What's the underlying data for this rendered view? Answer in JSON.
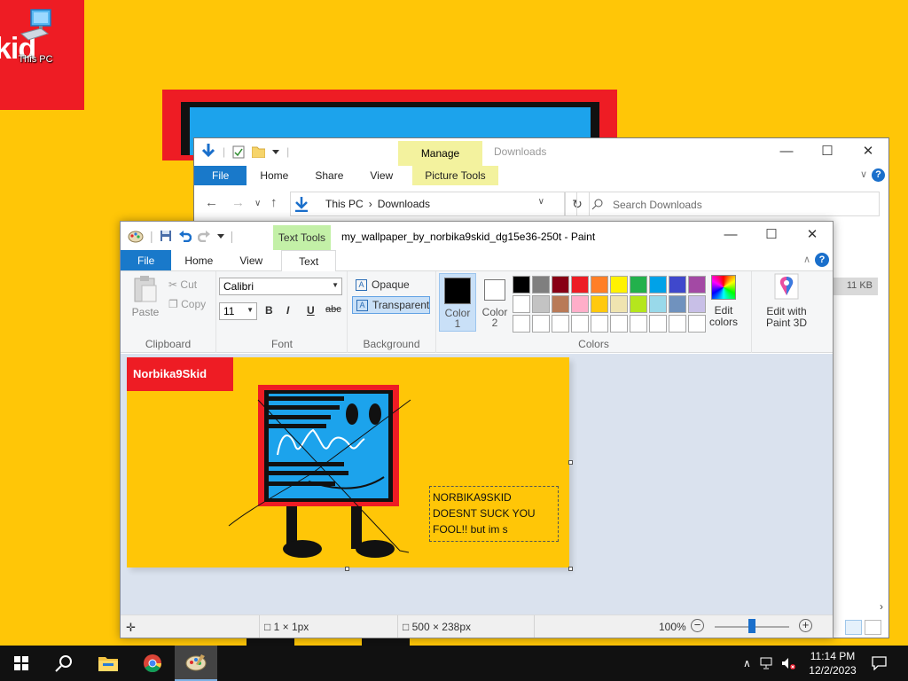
{
  "desktop": {
    "wallpaper_label": "kid",
    "icon_label": "This PC",
    "colors": {
      "wallpaper": "#ffc607",
      "wallpaper_red": "#ee1c24",
      "monitor_blue": "#1ca3ec"
    }
  },
  "explorer": {
    "title": "Downloads",
    "manage_label": "Manage",
    "tabs": [
      "File",
      "Home",
      "Share",
      "View",
      "Picture Tools"
    ],
    "breadcrumb": [
      "This PC",
      "Downloads"
    ],
    "search_placeholder": "Search Downloads",
    "size_value": "11 KB",
    "icons": [
      "download-icon",
      "properties-icon",
      "folder-icon",
      "back-icon",
      "forward-icon",
      "up-icon",
      "refresh-icon",
      "search-icon"
    ]
  },
  "paint": {
    "contextual_tab": "Text Tools",
    "title": "my_wallpaper_by_norbika9skid_dg15e36-250t - Paint",
    "tabs": {
      "file": "File",
      "home": "Home",
      "view": "View",
      "text": "Text"
    },
    "clipboard": {
      "group": "Clipboard",
      "paste": "Paste",
      "cut": "Cut",
      "copy": "Copy"
    },
    "font": {
      "group": "Font",
      "family": "Calibri",
      "size": "11",
      "bold": "B",
      "italic": "I",
      "underline": "U",
      "strike": "abc"
    },
    "background": {
      "group": "Background",
      "opaque": "Opaque",
      "transparent": "Transparent",
      "selected": "Transparent"
    },
    "colors": {
      "group": "Colors",
      "color1_label": "Color",
      "color1_num": "1",
      "color2_label": "Color",
      "color2_num": "2",
      "color1": "#000000",
      "color2": "#ffffff",
      "palette": [
        "#000000",
        "#7f7f7f",
        "#880015",
        "#ed1c24",
        "#ff7f27",
        "#fff200",
        "#22b14c",
        "#00a2e8",
        "#3f48cc",
        "#a349a4",
        "#ffffff",
        "#c3c3c3",
        "#b97a57",
        "#ffaec9",
        "#ffc90e",
        "#efe4b0",
        "#b5e61d",
        "#99d9ea",
        "#7092be",
        "#c8bfe7",
        "#ffffff",
        "#ffffff",
        "#ffffff",
        "#ffffff",
        "#ffffff",
        "#ffffff",
        "#ffffff",
        "#ffffff",
        "#ffffff",
        "#ffffff"
      ],
      "edit_colors_1": "Edit",
      "edit_colors_2": "colors",
      "edit_3d_1": "Edit with",
      "edit_3d_2": "Paint 3D"
    },
    "canvas": {
      "badge": "Norbika9Skid",
      "text_lines": [
        "NORBIKA9SKID",
        "DOESNT SUCK YOU",
        "FOOL!! but im s"
      ],
      "bg": "#ffc607",
      "red": "#ee1c24",
      "blue": "#1ca3ec"
    },
    "status": {
      "cursor": "1 × 1px",
      "size": "500 × 238px",
      "zoom": "100%",
      "zoom_fraction": 0.5
    }
  },
  "taskbar": {
    "time": "11:14 PM",
    "date": "12/2/2023",
    "apps": [
      "start-icon",
      "search-icon",
      "file-explorer-icon",
      "chrome-icon",
      "paint-icon"
    ]
  }
}
